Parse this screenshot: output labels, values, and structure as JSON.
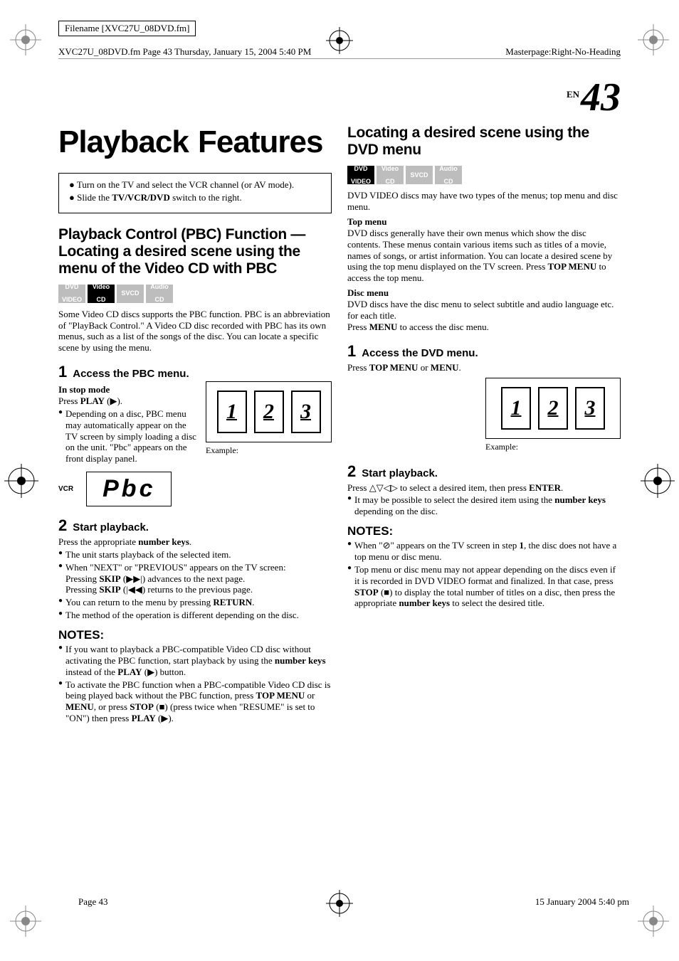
{
  "filename": "Filename [XVC27U_08DVD.fm]",
  "filepath_left": "XVC27U_08DVD.fm  Page 43  Thursday, January 15, 2004  5:40 PM",
  "filepath_right": "Masterpage:Right-No-Heading",
  "page_num_en": "EN",
  "page_num": "43",
  "main_title": "Playback Features",
  "intro": {
    "b1_a": "Turn on the TV and select the VCR channel (or AV mode).",
    "b2_a": "Slide the ",
    "b2_b": "TV/VCR/DVD",
    "b2_c": " switch to the right."
  },
  "badges": {
    "dvd1": "DVD",
    "dvd2": "VIDEO",
    "vcd1": "Video",
    "vcd2": "CD",
    "svcd": "SVCD",
    "acd1": "Audio",
    "acd2": "CD"
  },
  "pbc": {
    "title": "Playback Control (PBC) Function — Locating a desired scene using the menu of the Video CD with PBC",
    "desc": "Some Video CD discs supports the PBC function. PBC is an abbreviation of \"PlayBack Control.\" A Video CD disc recorded with PBC has its own menus, such as a list of the songs of the disc. You can locate a specific scene by using the menu.",
    "s1_num": "1",
    "s1_title": "Access the PBC menu.",
    "s1_stop": "In stop mode",
    "s1_press_a": "Press ",
    "s1_press_b": "PLAY",
    "s1_press_c": " (▶).",
    "s1_b1": "Depending on a disc, PBC menu may automatically appear on the TV screen by simply loading a disc on the unit. \"Pbc\" appears on the front display panel.",
    "example": "Example:",
    "scene1": "1",
    "scene2": "2",
    "scene3": "3",
    "lcd_label": "VCR",
    "lcd_text": "Pbc",
    "s2_num": "2",
    "s2_title": "Start playback.",
    "s2_press_a": "Press the appropriate ",
    "s2_press_b": "number keys",
    "s2_press_c": ".",
    "s2_b1": "The unit starts playback of the selected item.",
    "s2_b2": "When \"NEXT\" or \"PREVIOUS\" appears on the TV screen:",
    "s2_b2a_a": "Pressing ",
    "s2_b2a_b": "SKIP",
    "s2_b2a_c": " (▶▶|) advances to the next page.",
    "s2_b2b_a": "Pressing ",
    "s2_b2b_b": "SKIP",
    "s2_b2b_c": " (|◀◀) returns to the previous page.",
    "s2_b3_a": "You can return to the menu by pressing ",
    "s2_b3_b": "RETURN",
    "s2_b3_c": ".",
    "s2_b4": "The method of the operation is different depending on the disc.",
    "notes_hdr": "NOTES:",
    "n1_a": "If you want to playback a PBC-compatible Video CD disc without activating the PBC function, start playback by using the ",
    "n1_b": "number keys",
    "n1_c": " instead of the ",
    "n1_d": "PLAY",
    "n1_e": " (▶) button.",
    "n2_a": "To activate the PBC function when a PBC-compatible Video CD disc is being played back without the PBC function, press ",
    "n2_b": "TOP MENU",
    "n2_c": " or ",
    "n2_d": "MENU",
    "n2_e": ", or press ",
    "n2_f": "STOP",
    "n2_g": " (■) (press twice when \"RESUME\" is set to \"ON\") then press ",
    "n2_h": "PLAY",
    "n2_i": " (▶)."
  },
  "dvd": {
    "title": "Locating a desired scene using the DVD menu",
    "desc": "DVD VIDEO discs may have two types of the menus; top menu and disc menu.",
    "top_h": "Top menu",
    "top_p_a": "DVD discs generally have their own menus which show the disc contents. These menus contain various items such as titles of a movie, names of songs, or artist information. You can locate a desired scene by using the top menu displayed on the TV screen. Press ",
    "top_p_b": "TOP MENU",
    "top_p_c": " to access the top menu.",
    "disc_h": "Disc menu",
    "disc_p1": "DVD discs have the disc menu to select subtitle and audio language etc. for each title.",
    "disc_p2_a": "Press ",
    "disc_p2_b": "MENU",
    "disc_p2_c": " to access the disc menu.",
    "s1_num": "1",
    "s1_title": "Access the DVD menu.",
    "s1_press_a": "Press ",
    "s1_press_b": "TOP MENU",
    "s1_press_c": " or ",
    "s1_press_d": "MENU",
    "s1_press_e": ".",
    "example": "Example:",
    "s2_num": "2",
    "s2_title": "Start playback.",
    "s2_press_a": "Press △▽◁▷ to select a desired item, then press ",
    "s2_press_b": "ENTER",
    "s2_press_c": ".",
    "s2_b1_a": "It may be possible to select the desired item using the ",
    "s2_b1_b": "number keys",
    "s2_b1_c": " depending on the disc.",
    "notes_hdr": "NOTES:",
    "n1_a": "When \"⊘\" appears on the TV screen in step ",
    "n1_b": "1",
    "n1_c": ", the disc does not have a top menu or disc menu.",
    "n2_a": "Top menu or disc menu may not appear depending on the discs even if it is recorded in DVD VIDEO format and finalized. In that case, press ",
    "n2_b": "STOP",
    "n2_c": " (■) to display the total number of titles on a disc, then press the appropriate ",
    "n2_d": "number keys",
    "n2_e": " to select the desired title."
  },
  "footer": {
    "left": "Page 43",
    "right": "15 January 2004 5:40 pm"
  }
}
